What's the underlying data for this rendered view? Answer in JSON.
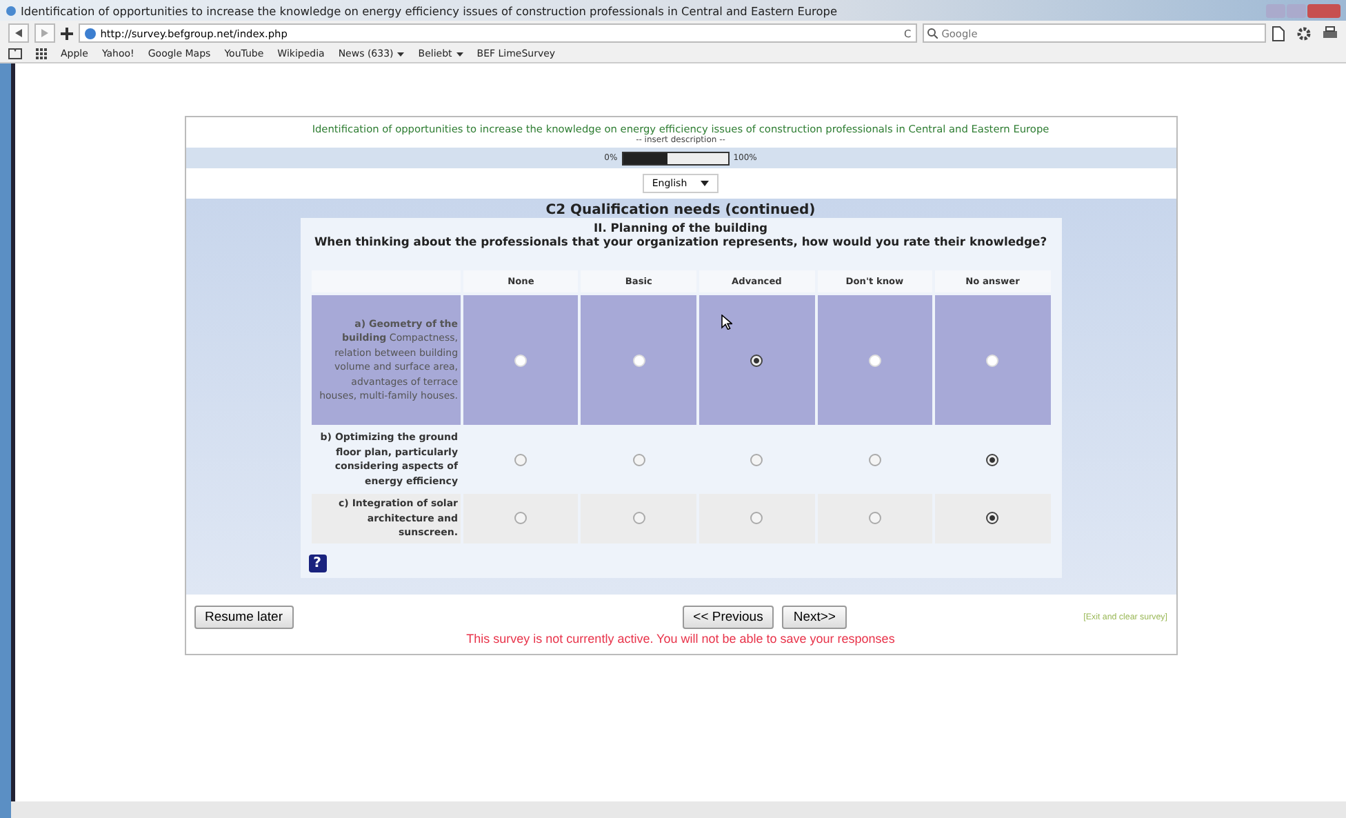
{
  "window": {
    "title": "Identification of opportunities to increase the knowledge on energy efficiency issues of construction professionals in Central and Eastern Europe"
  },
  "browser": {
    "url": "http://survey.befgroup.net/index.php",
    "reload": "C",
    "search_placeholder": "Google",
    "bookmarks": [
      {
        "label": "Apple",
        "menu": false
      },
      {
        "label": "Yahoo!",
        "menu": false
      },
      {
        "label": "Google Maps",
        "menu": false
      },
      {
        "label": "YouTube",
        "menu": false
      },
      {
        "label": "Wikipedia",
        "menu": false
      },
      {
        "label": "News (633)",
        "menu": true
      },
      {
        "label": "Beliebt",
        "menu": true
      },
      {
        "label": "BEF LimeSurvey",
        "menu": false
      }
    ]
  },
  "survey": {
    "title": "Identification of opportunities to increase the knowledge on energy efficiency issues of construction professionals in Central and Eastern Europe",
    "description": "-- insert description --",
    "progress": {
      "start": "0%",
      "end": "100%",
      "level": 0.42
    },
    "language": "English",
    "group": "C2 Qualification needs (continued)",
    "subheading": "II. Planning of the building",
    "question": "When thinking about the professionals that your organization represents, how would you rate their knowledge?",
    "columns": [
      "None",
      "Basic",
      "Advanced",
      "Don't know",
      "No answer"
    ],
    "rows": [
      {
        "label": "**a) Geometry of the building** Compactness, relation between building volume and surface area, advantages of terrace houses, multi-family houses.",
        "highlighted": true,
        "options": [
          {
            "selected": false
          },
          {
            "selected": false
          },
          {
            "selected": true
          },
          {
            "selected": false
          },
          {
            "selected": false
          }
        ]
      },
      {
        "label": "**b) Optimizing the ground floor plan, particularly considering aspects of energy efficiency**",
        "highlighted": false,
        "options": [
          {
            "selected": false
          },
          {
            "selected": false
          },
          {
            "selected": false
          },
          {
            "selected": false
          },
          {
            "selected": true
          }
        ]
      },
      {
        "label": "**c) Integration of solar architecture and sunscreen.**",
        "highlighted": false,
        "options": [
          {
            "selected": false
          },
          {
            "selected": false
          },
          {
            "selected": false
          },
          {
            "selected": false
          },
          {
            "selected": true
          }
        ]
      }
    ],
    "help": "?",
    "buttons": {
      "resume": "Resume later",
      "previous": "<< Previous",
      "next": "Next>>",
      "exit": "[Exit and clear survey]"
    },
    "notice": "This survey is not currently active. You will not be able to save your responses"
  }
}
